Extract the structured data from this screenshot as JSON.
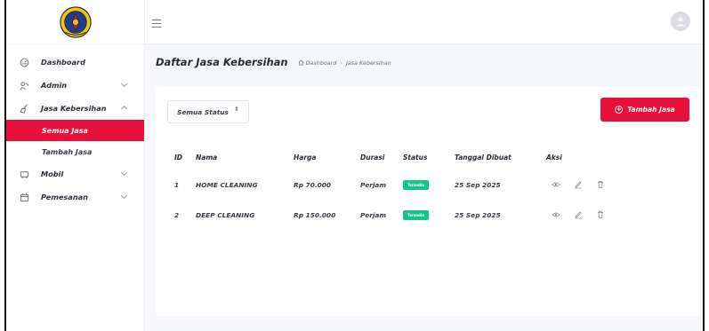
{
  "sidebar": {
    "items": [
      {
        "label": "Dashboard",
        "icon": "dashboard-icon",
        "has_children": false
      },
      {
        "label": "Admin",
        "icon": "admin-icon",
        "has_children": true
      },
      {
        "label": "Jasa Kebersihan",
        "icon": "cleaning-icon",
        "has_children": true,
        "expanded": true,
        "children": [
          {
            "label": "Semua Jasa",
            "active": true
          },
          {
            "label": "Tambah Jasa",
            "active": false
          }
        ]
      },
      {
        "label": "Mobil",
        "icon": "car-icon",
        "has_children": true
      },
      {
        "label": "Pemesanan",
        "icon": "calendar-icon",
        "has_children": true
      }
    ]
  },
  "header": {
    "menu_icon": "hamburger-icon",
    "avatar_icon": "user-avatar-icon"
  },
  "main": {
    "title": "Daftar Jasa Kebersihan",
    "breadcrumb": [
      "Dashboard",
      "Jasa Kebersihan"
    ],
    "filter": {
      "selected": "Semua Status",
      "arrow": "⇕"
    },
    "add_button": "Tambah Jasa",
    "table": {
      "columns": [
        "ID",
        "Nama",
        "Harga",
        "Durasi",
        "Status",
        "Tanggal Dibuat",
        "Aksi"
      ],
      "rows": [
        {
          "id": "1",
          "name": "HOME CLEANING",
          "price": "Rp 70.000",
          "duration": "Perjam",
          "status": "Tersedia",
          "date": "25 Sep 2025"
        },
        {
          "id": "2",
          "name": "DEEP CLEANING",
          "price": "Rp 150.000",
          "duration": "Perjam",
          "status": "Tersedia",
          "date": "25 Sep 2025"
        }
      ]
    }
  },
  "colors": {
    "accent": "#e8103a",
    "status_available": "#13c58b",
    "background": "#f6f7fb"
  }
}
